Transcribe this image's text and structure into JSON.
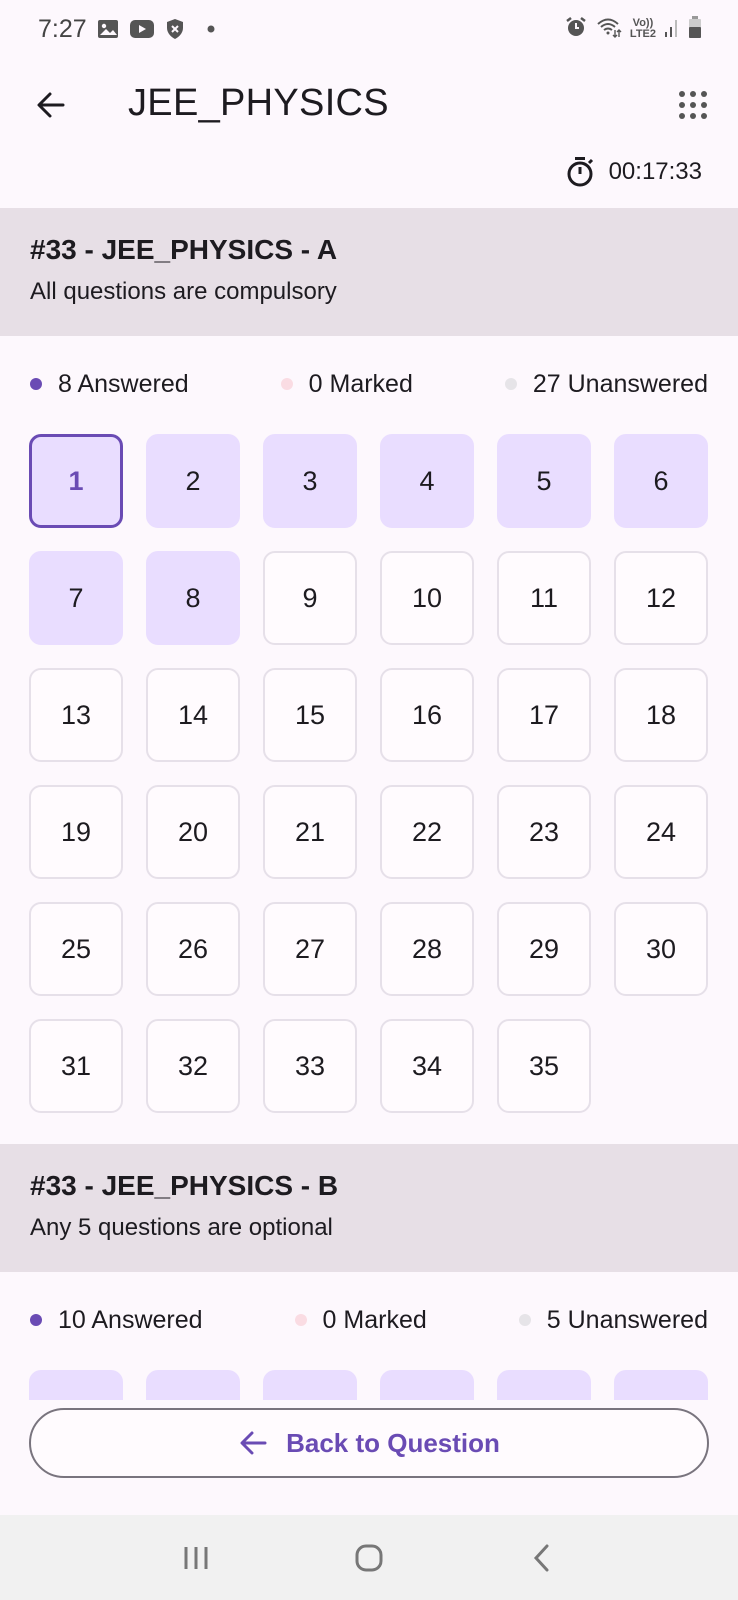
{
  "status_bar": {
    "time": "7:27",
    "left_icons": [
      "gallery-icon",
      "youtube-icon",
      "shield-icon",
      "dot-icon"
    ],
    "right_icons": [
      "alarm-icon",
      "wifi-icon",
      "volte-icon",
      "signal-icon",
      "battery-icon"
    ],
    "volte_top": "Vo))",
    "volte_bottom": "LTE2"
  },
  "app_bar": {
    "title": "JEE_PHYSICS",
    "back_icon": "arrow-back-icon",
    "menu_icon": "grid-dots-icon"
  },
  "timer": {
    "icon": "stopwatch-icon",
    "value": "00:17:33"
  },
  "sections": [
    {
      "title": "#33 - JEE_PHYSICS - A",
      "subtitle": "All questions are compulsory",
      "legend": {
        "answered": "8 Answered",
        "marked": "0 Marked",
        "unanswered": "27 Unanswered"
      },
      "questions": [
        {
          "n": "1",
          "state": "current"
        },
        {
          "n": "2",
          "state": "answered"
        },
        {
          "n": "3",
          "state": "answered"
        },
        {
          "n": "4",
          "state": "answered"
        },
        {
          "n": "5",
          "state": "answered"
        },
        {
          "n": "6",
          "state": "answered"
        },
        {
          "n": "7",
          "state": "answered"
        },
        {
          "n": "8",
          "state": "answered"
        },
        {
          "n": "9",
          "state": "unanswered"
        },
        {
          "n": "10",
          "state": "unanswered"
        },
        {
          "n": "11",
          "state": "unanswered"
        },
        {
          "n": "12",
          "state": "unanswered"
        },
        {
          "n": "13",
          "state": "unanswered"
        },
        {
          "n": "14",
          "state": "unanswered"
        },
        {
          "n": "15",
          "state": "unanswered"
        },
        {
          "n": "16",
          "state": "unanswered"
        },
        {
          "n": "17",
          "state": "unanswered"
        },
        {
          "n": "18",
          "state": "unanswered"
        },
        {
          "n": "19",
          "state": "unanswered"
        },
        {
          "n": "20",
          "state": "unanswered"
        },
        {
          "n": "21",
          "state": "unanswered"
        },
        {
          "n": "22",
          "state": "unanswered"
        },
        {
          "n": "23",
          "state": "unanswered"
        },
        {
          "n": "24",
          "state": "unanswered"
        },
        {
          "n": "25",
          "state": "unanswered"
        },
        {
          "n": "26",
          "state": "unanswered"
        },
        {
          "n": "27",
          "state": "unanswered"
        },
        {
          "n": "28",
          "state": "unanswered"
        },
        {
          "n": "29",
          "state": "unanswered"
        },
        {
          "n": "30",
          "state": "unanswered"
        },
        {
          "n": "31",
          "state": "unanswered"
        },
        {
          "n": "32",
          "state": "unanswered"
        },
        {
          "n": "33",
          "state": "unanswered"
        },
        {
          "n": "34",
          "state": "unanswered"
        },
        {
          "n": "35",
          "state": "unanswered"
        }
      ]
    },
    {
      "title": "#33 - JEE_PHYSICS - B",
      "subtitle": "Any 5 questions are optional",
      "legend": {
        "answered": "10 Answered",
        "marked": "0 Marked",
        "unanswered": "5 Unanswered"
      },
      "questions": [
        {
          "n": "",
          "state": "answered"
        },
        {
          "n": "",
          "state": "answered"
        },
        {
          "n": "",
          "state": "answered"
        },
        {
          "n": "",
          "state": "answered"
        },
        {
          "n": "",
          "state": "answered"
        },
        {
          "n": "",
          "state": "answered"
        }
      ]
    }
  ],
  "colors": {
    "answered": "#6a4bb4",
    "marked": "#fadce3",
    "unanswered": "#e6e4e8",
    "answered_bg": "#e9ddff",
    "header_bg": "#e7dfe6"
  },
  "footer": {
    "back_to_question_label": "Back to Question",
    "back_icon": "arrow-back-icon"
  },
  "nav_bar": {
    "buttons": [
      "recent-apps-icon",
      "home-icon",
      "back-icon"
    ]
  }
}
